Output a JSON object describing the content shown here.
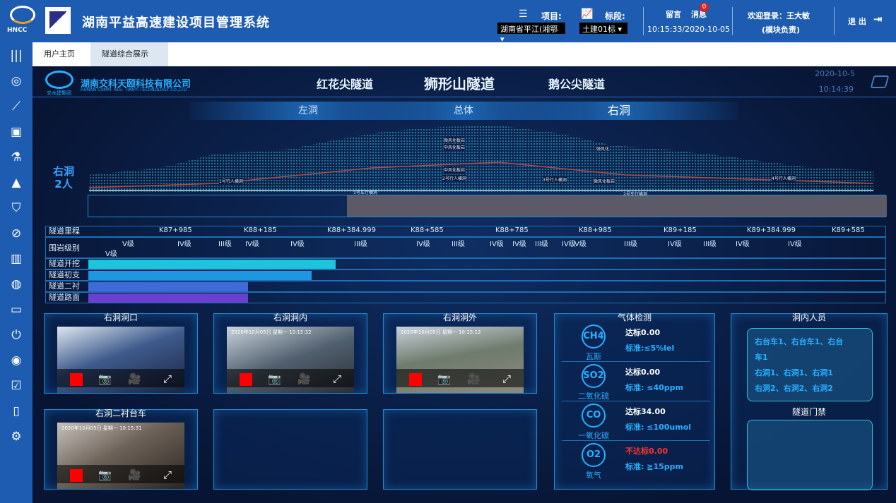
{
  "header": {
    "logo_text": "HNCC",
    "app_title": "湖南平益高速建设项目管理系统",
    "project_label": "项目:",
    "project_value": "湖南省平江(湘鄂",
    "section_label": "标段:",
    "section_value": "土建01标",
    "msg_label": "留言",
    "notice_label": "消息",
    "notice_badge": "0",
    "clock": "10:15:33/2020-10-05",
    "welcome": "欢迎登录：王大敏",
    "role": "(模块负责)",
    "logout": "退 出"
  },
  "tabs": [
    "用户主页",
    "隧道综合展示"
  ],
  "dashboard": {
    "company": "湖南交科天颐科技有限公司",
    "company_en": "HUNAN COMM. RES. TIANYI TECHNOLOGY CO.,LTD",
    "group": "交水建集团",
    "tunnels": [
      "红花尖隧道",
      "狮形山隧道",
      "鹅公尖隧道"
    ],
    "date": "2020-10-5",
    "time": "10:14:39",
    "segments": [
      "左洞",
      "总体",
      "右洞"
    ],
    "right_tunnel": "右洞",
    "people_count": "2人",
    "profile_labels": [
      "1号行人横洞",
      "1号车行横洞",
      "2号行人横洞",
      "3号行人横洞",
      "2号车行横洞",
      "4号行人横洞",
      "微风化板岩",
      "中风化板岩",
      "强风化",
      "微风化板岩",
      "中风化板岩",
      "平江侧洞门桩号",
      "K87+785",
      "K89+595",
      "K88+652",
      "K88+103",
      "K88+602",
      "新墙岩",
      "新墙岩",
      "断层带",
      "断层带",
      "新墙岩",
      "断层带",
      "K89+42",
      "伍市侧洞门桩号"
    ]
  },
  "table": {
    "rows": [
      "隧道里程",
      "围岩级别",
      "隧道开挖",
      "隧道初支",
      "隧道二衬",
      "隧道路面"
    ],
    "mileage": [
      "K87+985",
      "K88+185",
      "K88+384.999",
      "K88+585",
      "K88+785",
      "K88+985",
      "K89+185",
      "K89+384.999",
      "K89+585"
    ],
    "grades": [
      "V级",
      "IV级",
      "III级",
      "IV级",
      "IV级",
      "III级",
      "IV级",
      "III级",
      "IV级",
      "级",
      "IV级",
      "III级",
      "IV级",
      "V级",
      "IV级",
      "III级",
      "IV级",
      "III级",
      "IV级",
      "级",
      "IV级",
      "V级"
    ],
    "progress": [
      0.31,
      0.28,
      0.2,
      0.2
    ]
  },
  "cameras": [
    {
      "title": "右洞洞口",
      "caption": ""
    },
    {
      "title": "右洞洞内",
      "caption": "2020年10月05日 星期一 10:15:32"
    },
    {
      "title": "右洞洞外",
      "caption": "2020年10月05日 星期一 10:15:12"
    },
    {
      "title": "右洞二衬台车",
      "caption": "2020年10月05日 星期一 10:15:31"
    }
  ],
  "gas": {
    "title": "气体检测",
    "items": [
      {
        "symbol": "CH4",
        "name": "瓦斯",
        "value": "达标0.00",
        "std": "标准:≤5%lel",
        "color": "#ffffff"
      },
      {
        "symbol": "SO2",
        "name": "二氧化硫",
        "value": "达标0.00",
        "std": "标准: ≤40ppm",
        "color": "#ffffff"
      },
      {
        "symbol": "CO",
        "name": "一氧化碳",
        "value": "达标34.00",
        "std": "标准: ≤100umol",
        "color": "#ffffff"
      },
      {
        "symbol": "O2",
        "name": "氧气",
        "value": "不达标0.00",
        "std": "标准: ≧15ppm",
        "color": "#ff3030"
      }
    ]
  },
  "people": {
    "title": "洞内人员",
    "lines": [
      "右台车1、右台车1、右台",
      "车1",
      "右洞1、右洞1、右洞1",
      "右洞2、右洞2、右洞2"
    ],
    "door_title": "隧道门禁"
  }
}
